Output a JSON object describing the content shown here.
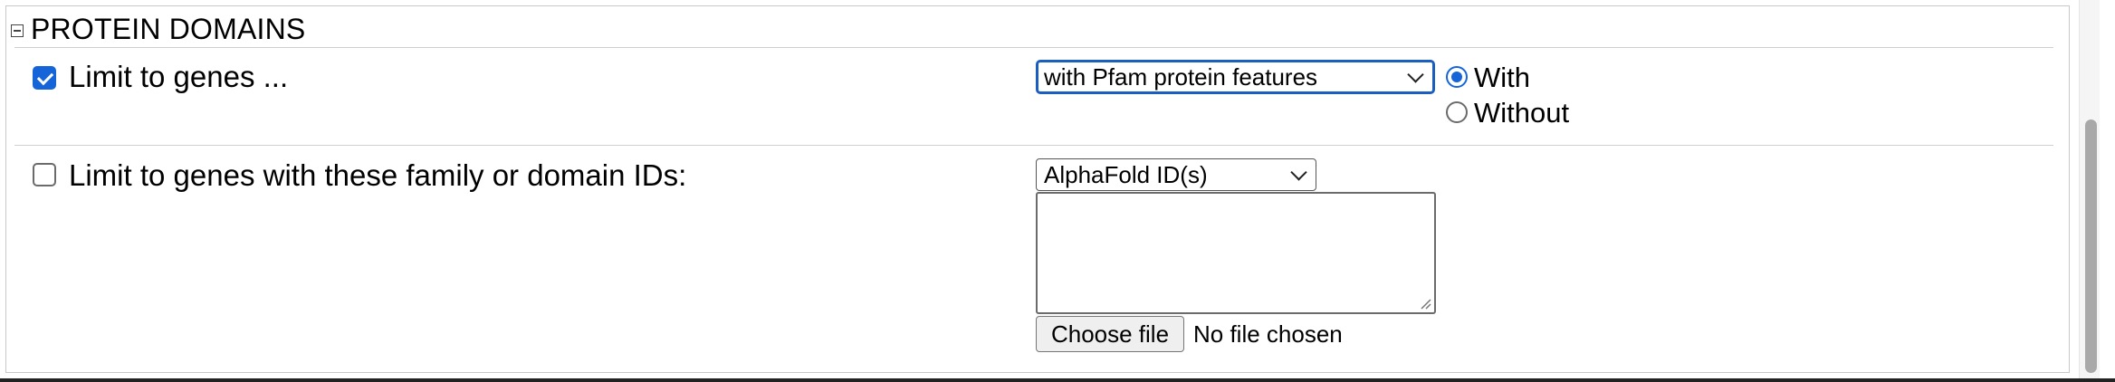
{
  "section": {
    "title": "PROTEIN DOMAINS"
  },
  "row1": {
    "checked": true,
    "label": "Limit to genes ...",
    "select_value": "with Pfam protein features",
    "radio_with": "With",
    "radio_without": "Without",
    "radio_selected": "With"
  },
  "row2": {
    "checked": false,
    "label": "Limit to genes with these family or domain IDs:",
    "select_value": "AlphaFold ID(s)",
    "textarea_value": "",
    "file_button": "Choose file",
    "file_status": "No file chosen"
  },
  "colors": {
    "accent": "#1565d8",
    "focus_border": "#1a5fc0"
  }
}
